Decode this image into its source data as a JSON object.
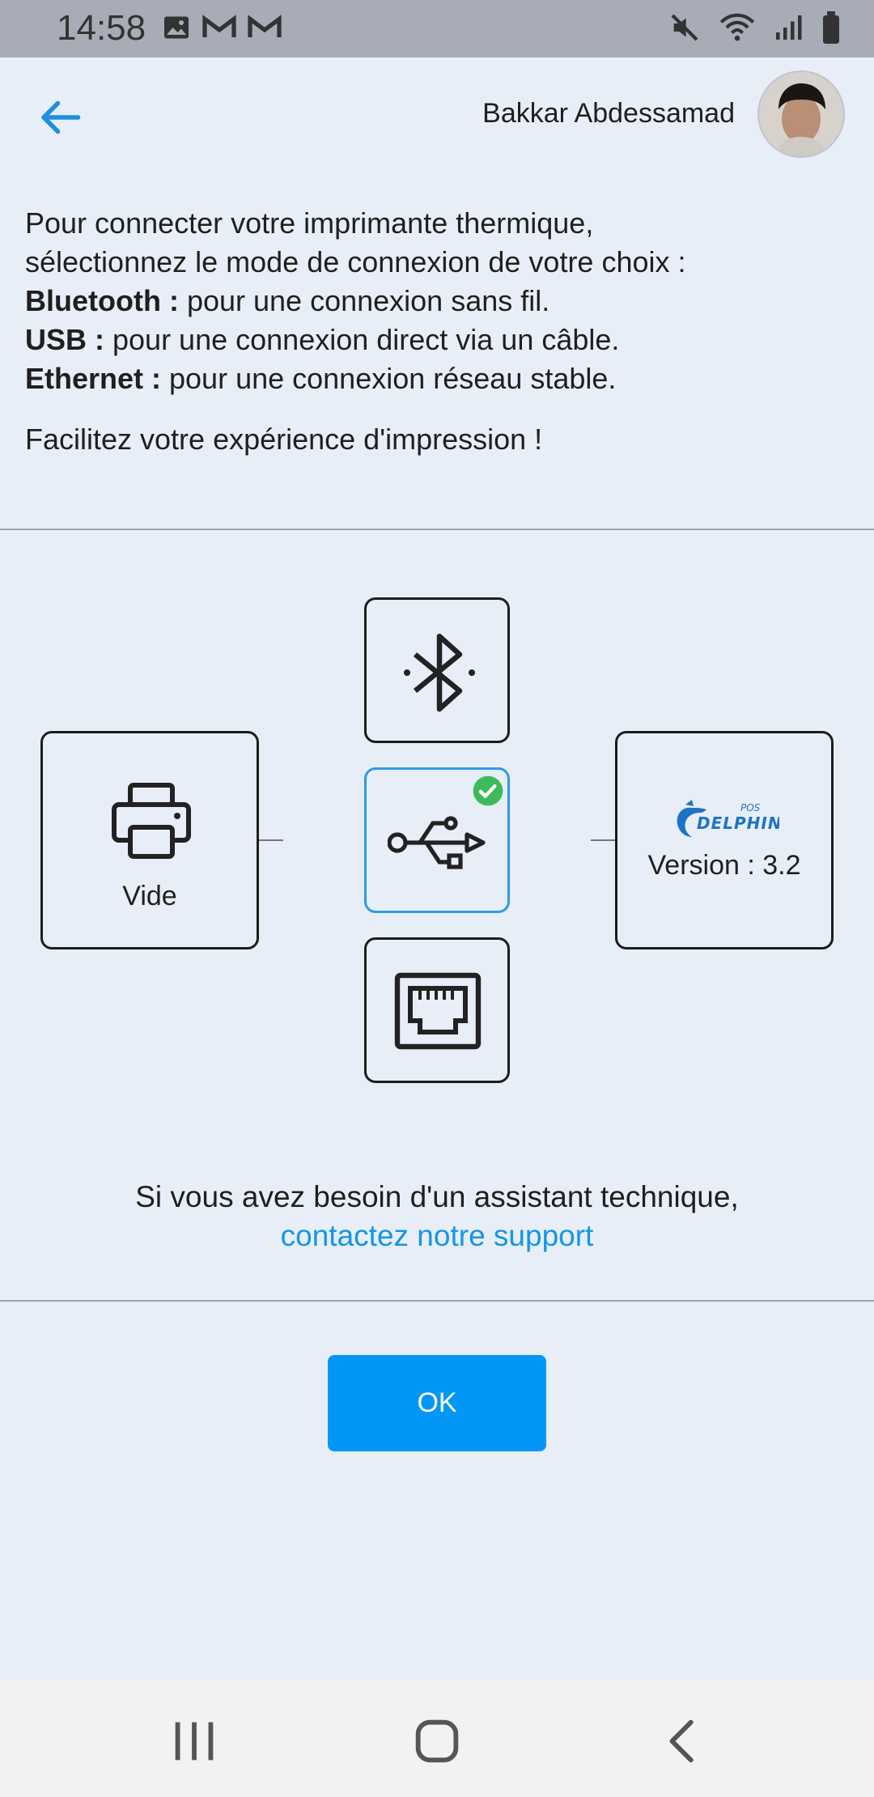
{
  "status": {
    "time": "14:58"
  },
  "header": {
    "user_name": "Bakkar Abdessamad"
  },
  "intro": {
    "line1": "Pour connecter votre imprimante thermique,",
    "line2": "sélectionnez le mode de connexion de votre choix :",
    "bluetooth_label": "Bluetooth :",
    "bluetooth_desc": " pour une connexion sans fil.",
    "usb_label": "USB :",
    "usb_desc": " pour une connexion direct via un câble.",
    "ethernet_label": "Ethernet :",
    "ethernet_desc": " pour une connexion réseau stable.",
    "tagline": "Facilitez votre expérience d'impression !"
  },
  "diagram": {
    "printer_label": "Vide",
    "logo_small": "POS",
    "logo_big": "DELPHIN",
    "version_label": "Version : 3.2",
    "selected": "usb"
  },
  "help": {
    "text": "Si vous avez besoin d'un assistant technique,",
    "link": "contactez notre support"
  },
  "actions": {
    "ok_label": "OK"
  },
  "colors": {
    "accent": "#0296f7",
    "link": "#1496e6",
    "check": "#3dbb5c",
    "background": "#e8eef8"
  }
}
